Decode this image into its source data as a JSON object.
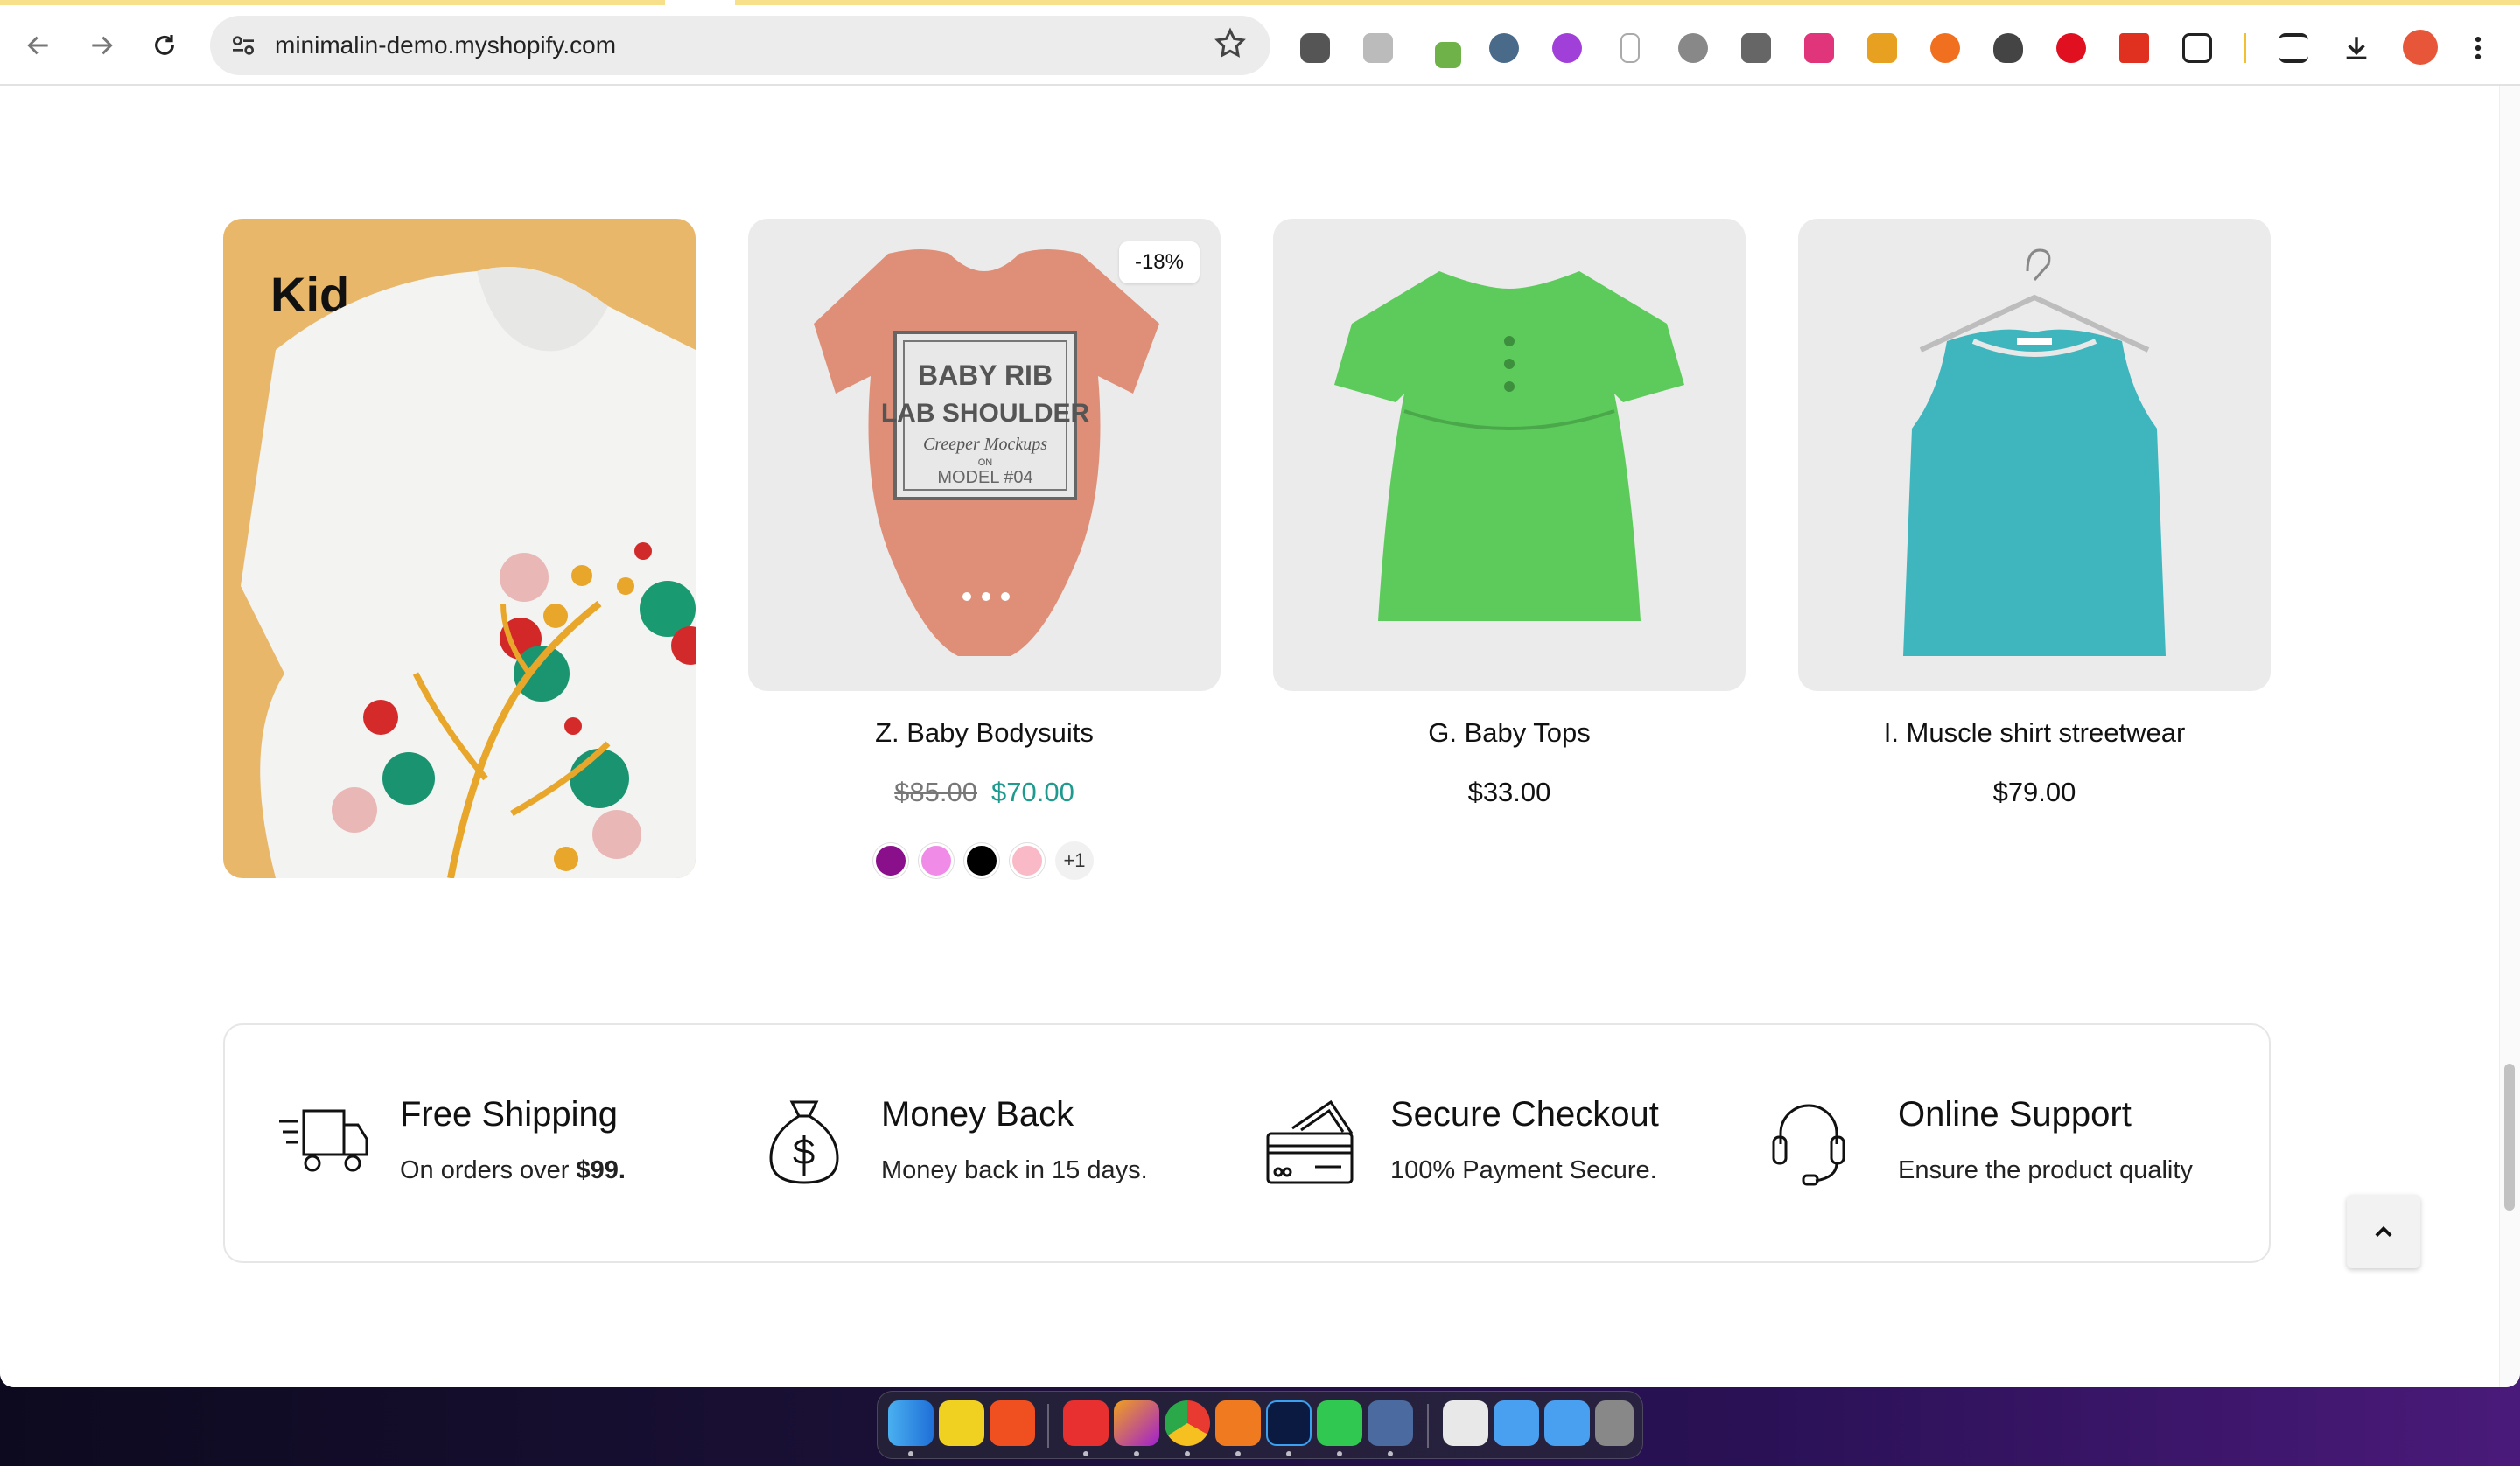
{
  "browser": {
    "url": "minimalin-demo.myshopify.com"
  },
  "kid_card": {
    "title": "Kid"
  },
  "products": [
    {
      "name": "Z. Baby Bodysuits",
      "old_price": "$85.00",
      "price": "$70.00",
      "badge": "-18%",
      "swatches": [
        "#8a0f8a",
        "#f08ce8",
        "#000000",
        "#f9b9c6"
      ],
      "more": "+1",
      "print": {
        "line1": "BABY RIB",
        "line2": "LAB SHOULDER",
        "line3": "Creeper Mockups",
        "line4": "ON",
        "line5": "MODEL #04"
      }
    },
    {
      "name": "G. Baby Tops",
      "price": "$33.00"
    },
    {
      "name": "I. Muscle shirt streetwear",
      "price": "$79.00"
    }
  ],
  "features": [
    {
      "title": "Free Shipping",
      "desc_prefix": "On orders over ",
      "desc_bold": "$99.",
      "icon": "truck-icon"
    },
    {
      "title": "Money Back",
      "desc": "Money back in 15 days.",
      "icon": "money-bag-icon"
    },
    {
      "title": "Secure Checkout",
      "desc": "100% Payment Secure.",
      "icon": "credit-card-icon"
    },
    {
      "title": "Online Support",
      "desc": "Ensure the product quality",
      "icon": "headset-icon"
    }
  ],
  "colors": {
    "sale_price": "#1f9a8e",
    "kid_bg": "#e8b76a",
    "card_bg": "#ebebeb"
  }
}
